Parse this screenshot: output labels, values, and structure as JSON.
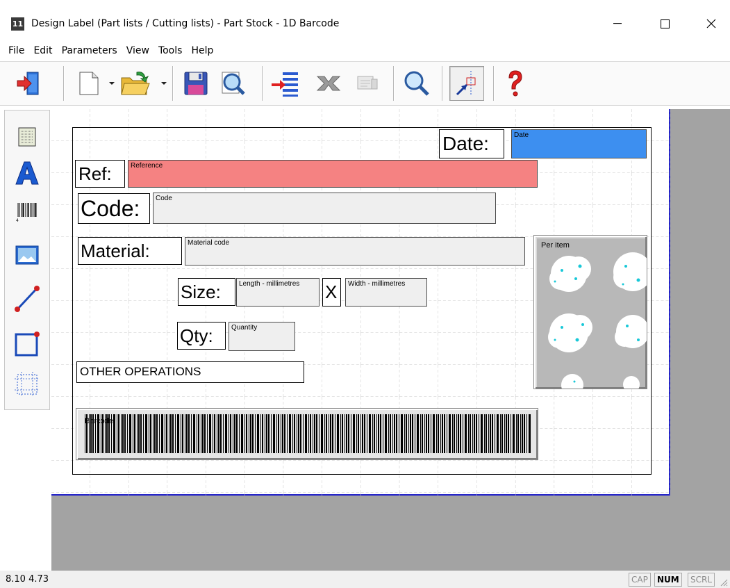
{
  "window": {
    "app_icon_text": "11",
    "title": "Design Label (Part lists / Cutting lists) - Part Stock - 1D Barcode"
  },
  "menu": [
    "File",
    "Edit",
    "Parameters",
    "View",
    "Tools",
    "Help"
  ],
  "label": {
    "date_label": "Date:",
    "date_field": "Date",
    "ref_label": "Ref:",
    "ref_field": "Reference",
    "code_label": "Code:",
    "code_field": "Code",
    "material_label": "Material:",
    "material_field": "Material code",
    "size_label": "Size:",
    "length_field": "Length - millimetres",
    "x_label": "X",
    "width_field": "Width - millimetres",
    "qty_label": "Qty:",
    "qty_field": "Quantity",
    "other_operations": "OTHER OPERATIONS",
    "image_caption": "Per item",
    "barcode_field": "Barcode"
  },
  "colors": {
    "date_field": "#3d8ff0",
    "ref_field": "#f58282",
    "field_default": "#efefef",
    "sheet_border": "#2020c8",
    "canvas_bg": "#a3a3a3"
  },
  "status": {
    "coords": "8.10 4.73",
    "cap": "CAP",
    "num": "NUM",
    "scrl": "SCRL"
  }
}
